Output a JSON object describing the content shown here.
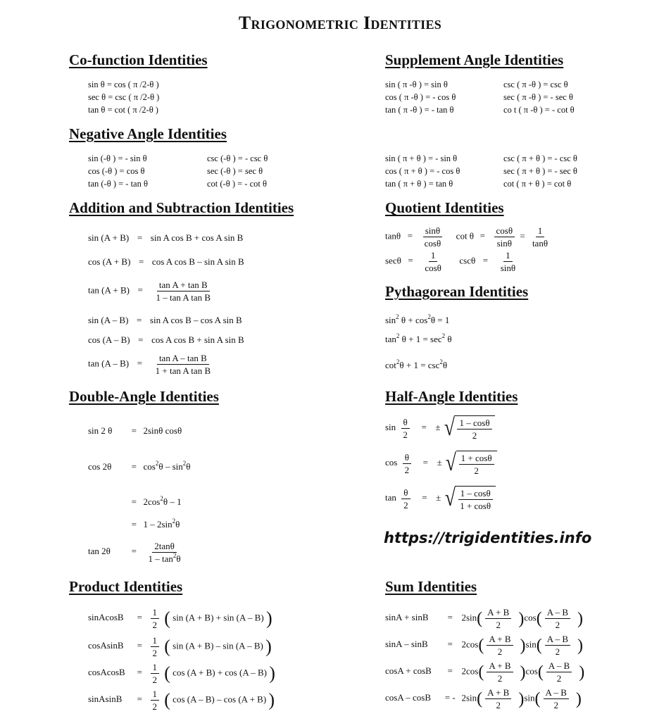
{
  "title": "Trigonometric Identities",
  "url": "https://trigidentities.info",
  "cofunction": {
    "heading": "Co-function Identities",
    "rows": [
      "sin θ  =  cos ( π /2-θ )",
      "sec θ  =  csc ( π /2-θ )",
      "tan θ  =  cot ( π /2-θ )"
    ]
  },
  "supplement": {
    "heading": "Supplement Angle Identities",
    "col1": [
      "sin ( π -θ )  =   sin θ",
      "cos ( π -θ )  =  - cos θ",
      "tan ( π -θ )  =  - tan θ"
    ],
    "col2": [
      "csc ( π -θ )  =   csc θ",
      "sec ( π -θ )  =  - sec θ",
      "co t ( π -θ )  =  - cot θ"
    ],
    "col3": [
      "sin ( π + θ )  =  - sin θ",
      "cos ( π + θ )  =  - cos θ",
      "tan ( π + θ )  =   tan θ"
    ],
    "col4": [
      "csc ( π + θ )  =  - csc θ",
      "sec ( π + θ )  =  - sec θ",
      "cot ( π + θ )  =    cot θ"
    ]
  },
  "negative": {
    "heading": "Negative Angle Identities",
    "col1": [
      "sin (-θ )  =  - sin θ",
      "cos (-θ )  =    cos θ",
      "tan (-θ )  =  - tan θ"
    ],
    "col2": [
      "csc (-θ )  =  - csc θ",
      "sec (-θ )  =    sec θ",
      "cot (-θ )  =  - cot θ"
    ]
  },
  "addsub": {
    "heading": "Addition and Subtraction Identities",
    "sin_sum": {
      "lhs": "sin (A + B)",
      "rhs": "sin A cos B + cos A sin B"
    },
    "cos_sum": {
      "lhs": "cos (A + B)",
      "rhs": "cos A cos B – sin A sin B"
    },
    "tan_sum": {
      "lhs": "tan (A + B)",
      "num": "tan A + tan B",
      "den": "1 – tan A tan B"
    },
    "sin_diff": {
      "lhs": "sin (A – B)",
      "rhs": "sin A cos B – cos A sin B"
    },
    "cos_diff": {
      "lhs": "cos (A – B)",
      "rhs": "cos A cos B + sin A sin B"
    },
    "tan_diff": {
      "lhs": "tan (A – B)",
      "num": "tan A – tan B",
      "den": "1 + tan A tan B"
    },
    "eq": "="
  },
  "quotient": {
    "heading": "Quotient Identities",
    "tan": {
      "lhs": "tanθ",
      "num": "sinθ",
      "den": "cosθ"
    },
    "cot": {
      "lhs": "cot θ",
      "num": "cosθ",
      "den": "sinθ",
      "num2": "1",
      "den2": "tanθ"
    },
    "sec": {
      "lhs": "secθ",
      "num": "1",
      "den": "cosθ"
    },
    "csc": {
      "lhs": "cscθ",
      "num": "1",
      "den": "sinθ"
    },
    "eq": "="
  },
  "pythagorean": {
    "heading": "Pythagorean Identities",
    "rows": [
      {
        "a": "sin",
        "b": " θ  + cos",
        "c": "θ  = 1"
      },
      {
        "a": "tan",
        "b": " θ  + 1 = sec",
        "c": " θ"
      },
      {
        "a": "cot",
        "b": "θ   + 1 = csc",
        "c": "θ"
      }
    ],
    "sq": "2"
  },
  "double": {
    "heading": "Double-Angle Identities",
    "sin2": {
      "lhs": "sin 2 θ",
      "rhs": "2sinθ   cosθ"
    },
    "cos2_lhs": "cos 2θ",
    "cos2_a": {
      "p1": "cos",
      "p2": "θ  – sin",
      "p3": "θ"
    },
    "cos2_b": {
      "p1": "2cos",
      "p2": "θ  – 1"
    },
    "cos2_c": {
      "p1": "1 – 2sin",
      "p2": "θ"
    },
    "tan2": {
      "lhs": "tan 2θ",
      "num": "2tanθ",
      "den_a": "1 – tan",
      "den_b": "θ"
    },
    "eq": "=",
    "sq": "2"
  },
  "half": {
    "heading": "Half-Angle Identities",
    "rows": [
      {
        "fn": "sin",
        "num": "1 – cosθ",
        "den": "2"
      },
      {
        "fn": "cos",
        "num": "1 + cosθ",
        "den": "2"
      },
      {
        "fn": "tan",
        "num": "1 – cosθ",
        "den": "1 + cosθ"
      }
    ],
    "theta": "θ",
    "two": "2",
    "eq": "=",
    "pm": "±",
    "rad": "√"
  },
  "product": {
    "heading": "Product Identities",
    "rows": [
      {
        "lhs": "sinAcosB",
        "inner": "sin (A + B) + sin (A – B)"
      },
      {
        "lhs": "cosAsinB",
        "inner": "sin (A + B) – sin (A – B)"
      },
      {
        "lhs": "cosAcosB",
        "inner": "cos (A + B) + cos (A – B)"
      },
      {
        "lhs": "sinAsinB",
        "inner": "cos (A – B) – cos (A + B)"
      }
    ],
    "one": "1",
    "two": "2",
    "eq": "=",
    "lp": "(",
    "rp": ")"
  },
  "sum": {
    "heading": "Sum Identities",
    "rows": [
      {
        "lhs": "sinA + sinB",
        "eq": "=",
        "f1": "2sin",
        "f2": "cos"
      },
      {
        "lhs": "sinA – sinB",
        "eq": "=",
        "f1": "2cos",
        "f2": "sin"
      },
      {
        "lhs": "cosA + cosB",
        "eq": "=",
        "f1": "2cos",
        "f2": "cos"
      },
      {
        "lhs": "cosA – cosB",
        "eq": "= -",
        "f1": "2sin",
        "f2": "sin"
      }
    ],
    "apb": "A + B",
    "amb": "A – B",
    "two": "2",
    "lp": "(",
    "rp": ")"
  }
}
